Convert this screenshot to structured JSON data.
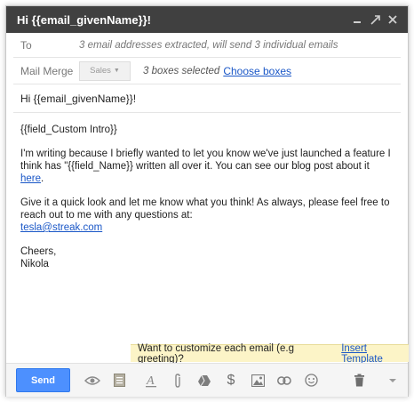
{
  "window": {
    "title": "Hi {{email_givenName}}!"
  },
  "to": {
    "label": "To",
    "value": "3 email addresses extracted, will send 3 individual emails"
  },
  "mail_merge": {
    "label": "Mail Merge",
    "selected": "Sales",
    "info": "3 boxes selected",
    "choose_link": "Choose boxes"
  },
  "subject": "Hi {{email_givenName}}!",
  "body": {
    "intro": "{{field_Custom Intro}}",
    "p1_text": "I'm writing because I briefly wanted to let you know we've just launched a feature I think has \"{{field_Name}} written all over it. You can see our blog post about it ",
    "p1_link": "here",
    "p1_end": ".",
    "p2_text": "Give it a quick look and let me know what you think! As always, please feel free to reach out to me with any questions at:",
    "p2_email": "tesla@streak.com",
    "sig1": "Cheers,",
    "sig2": "Nikola"
  },
  "tip": {
    "text": "Want to customize each email (e.g greeting)?",
    "link": "Insert Template"
  },
  "toolbar": {
    "send": "Send",
    "icons": [
      "eye-icon",
      "template-icon",
      "format-text-icon",
      "attach-icon",
      "drive-icon",
      "dollar-icon",
      "photo-icon",
      "link-icon",
      "emoji-icon",
      "trash-icon",
      "more-options-icon"
    ]
  },
  "colors": {
    "titlebar": "#404040",
    "send_button": "#4d90fe",
    "link": "#1a57c7",
    "tip_background": "#fcf4c7"
  }
}
